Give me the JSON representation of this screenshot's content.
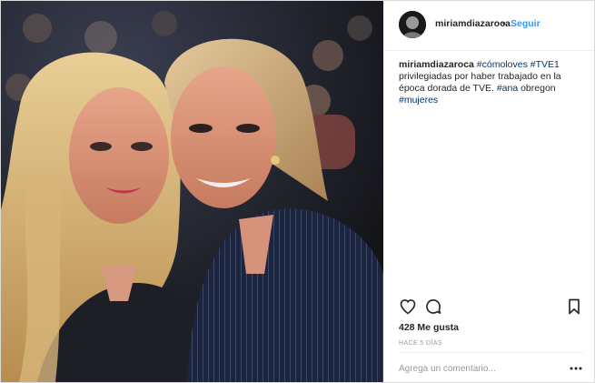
{
  "post": {
    "username": "miriamdiazaroca",
    "separator": "•",
    "follow_label": "Seguir",
    "caption": {
      "user": "miriamdiazaroca",
      "tag1": "#cómoloves",
      "tag2": "#TVE1",
      "text1": "privilegiadas por haber trabajado en la época dorada de TVE.",
      "tag3": "#ana",
      "text2": "obregon",
      "tag4": "#mujeres"
    },
    "likes_label": "428 Me gusta",
    "time_label": "HACE 5 DÍAS",
    "comment_placeholder": "Agrega un comentario...",
    "icons": {
      "like": "heart-icon",
      "comment": "comment-icon",
      "save": "bookmark-icon",
      "more": "more-options-icon"
    },
    "colors": {
      "link": "#3897f0",
      "hashtag": "#003569",
      "text": "#262626",
      "muted": "#999999"
    }
  }
}
